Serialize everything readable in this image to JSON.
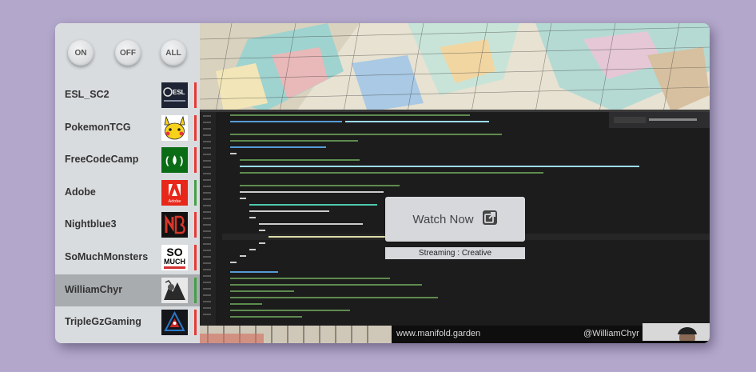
{
  "toggles": {
    "on": "ON",
    "off": "OFF",
    "all": "ALL"
  },
  "streamers": [
    {
      "name": "ESL_SC2",
      "thumb": "esl-sc2-logo",
      "status_color": "#e53935",
      "active": false
    },
    {
      "name": "PokemonTCG",
      "thumb": "pikachu-logo",
      "status_color": "#e53935",
      "active": false
    },
    {
      "name": "FreeCodeCamp",
      "thumb": "freecodecamp-logo",
      "status_color": "#e53935",
      "active": false
    },
    {
      "name": "Adobe",
      "thumb": "adobe-logo",
      "status_color": "#43a047",
      "active": false
    },
    {
      "name": "Nightblue3",
      "thumb": "nightblue3-logo",
      "status_color": "#e53935",
      "active": false
    },
    {
      "name": "SoMuchMonsters",
      "thumb": "somuchmonsters-logo",
      "status_color": "#e53935",
      "active": false
    },
    {
      "name": "WilliamChyr",
      "thumb": "williamchyr-avatar",
      "status_color": "#43a047",
      "active": true
    },
    {
      "name": "TripleGzGaming",
      "thumb": "triplegz-logo",
      "status_color": "#e53935",
      "active": false
    }
  ],
  "thumb_text": {
    "esl": "ESL",
    "adobe": "Adobe",
    "so": "SO",
    "much": "MUCH"
  },
  "preview": {
    "watch_label": "Watch Now",
    "watch_icon": "external-link-icon",
    "status": "Streaming : Creative",
    "footer_site": "www.manifold.garden",
    "footer_handle": "@WilliamChyr"
  },
  "colors": {
    "background": "#b3a8cc",
    "sidebar": "#d9dcdf",
    "active_row": "#a9acaf",
    "online": "#43a047",
    "offline": "#e53935"
  }
}
